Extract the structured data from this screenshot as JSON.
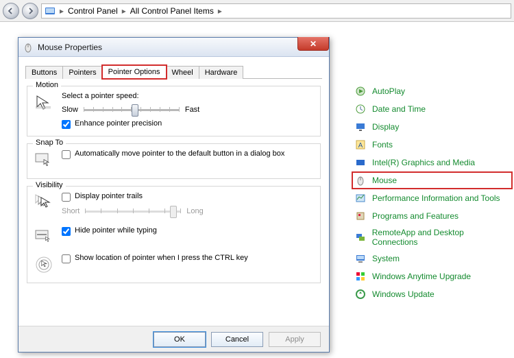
{
  "breadcrumb": {
    "root": "Control Panel",
    "level2": "All Control Panel Items"
  },
  "cp_items": [
    {
      "label": "AutoPlay"
    },
    {
      "label": "Date and Time"
    },
    {
      "label": "Display"
    },
    {
      "label": "Fonts"
    },
    {
      "label": "Intel(R) Graphics and Media"
    },
    {
      "label": "Mouse"
    },
    {
      "label": "Performance Information and Tools"
    },
    {
      "label": "Programs and Features"
    },
    {
      "label": "RemoteApp and Desktop Connections"
    },
    {
      "label": "System"
    },
    {
      "label": "Windows Anytime Upgrade"
    },
    {
      "label": "Windows Update"
    }
  ],
  "dialog": {
    "title": "Mouse Properties",
    "tabs": {
      "buttons": "Buttons",
      "pointers": "Pointers",
      "pointer_options": "Pointer Options",
      "wheel": "Wheel",
      "hardware": "Hardware"
    },
    "motion": {
      "legend": "Motion",
      "desc": "Select a pointer speed:",
      "slow": "Slow",
      "fast": "Fast",
      "enhance": "Enhance pointer precision"
    },
    "snap": {
      "legend": "Snap To",
      "auto_move": "Automatically move pointer to the default button in a dialog box"
    },
    "visibility": {
      "legend": "Visibility",
      "trails": "Display pointer trails",
      "short": "Short",
      "long": "Long",
      "hide_typing": "Hide pointer while typing",
      "show_ctrl": "Show location of pointer when I press the CTRL key"
    },
    "buttons": {
      "ok": "OK",
      "cancel": "Cancel",
      "apply": "Apply"
    }
  }
}
